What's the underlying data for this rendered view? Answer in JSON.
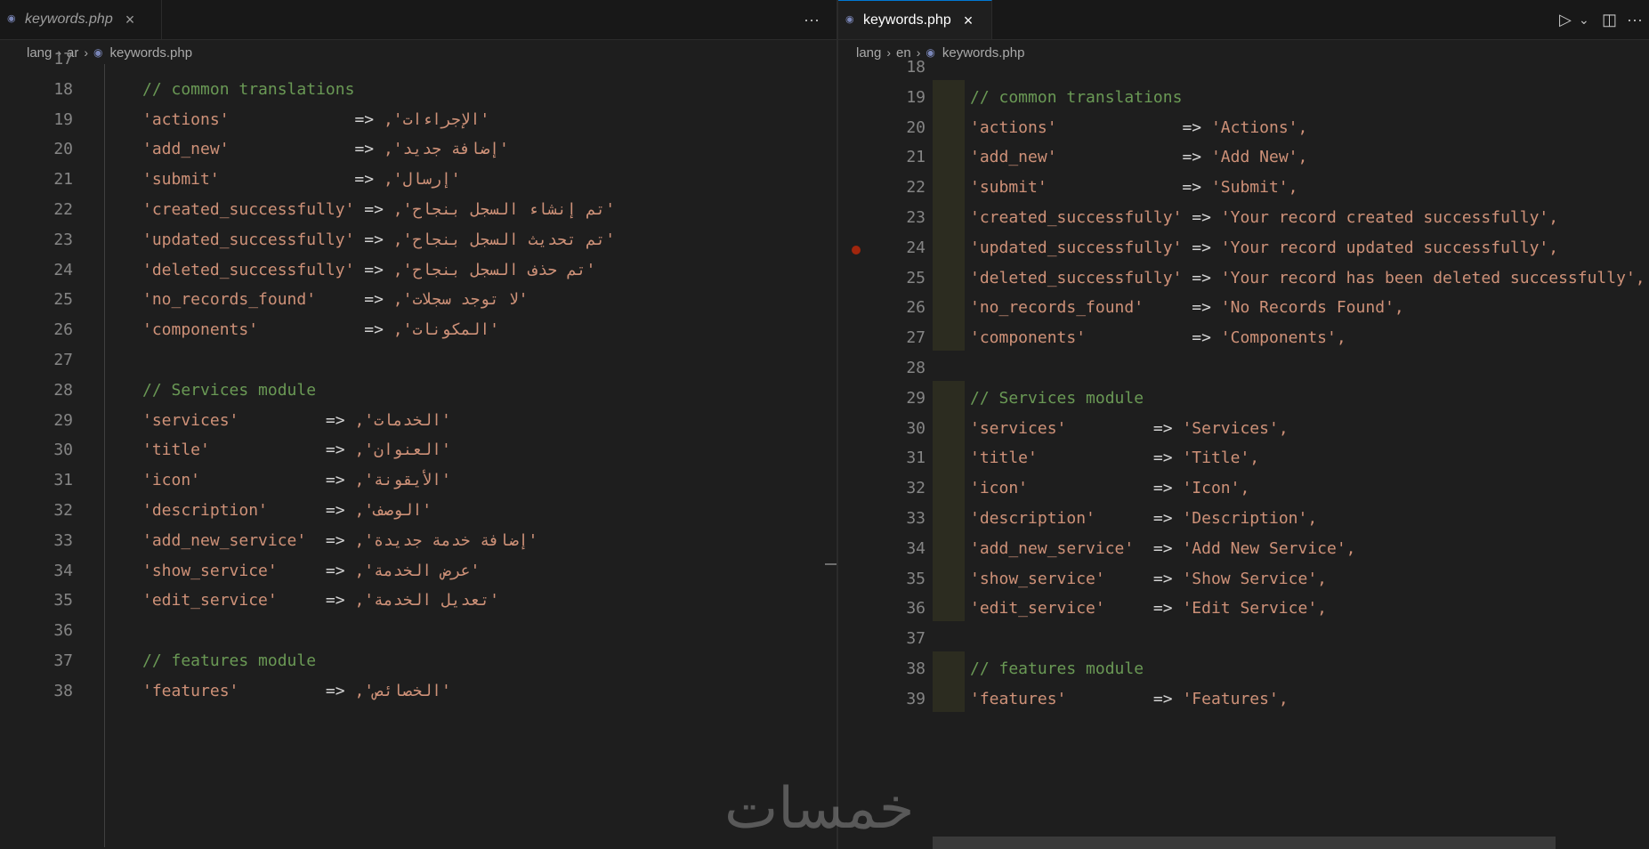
{
  "left": {
    "tab": {
      "label": "keywords.php",
      "close": "×"
    },
    "more": "···",
    "breadcrumb": [
      "lang",
      "ar",
      "keywords.php"
    ],
    "lines": [
      {
        "n": "17",
        "type": "blank"
      },
      {
        "n": "18",
        "type": "comment",
        "text": "// common translations"
      },
      {
        "n": "19",
        "type": "kv",
        "key": "'actions'",
        "pad": "             ",
        "value": "'الإجراءات',"
      },
      {
        "n": "20",
        "type": "kv",
        "key": "'add_new'",
        "pad": "             ",
        "value": "'إضافة جديد',"
      },
      {
        "n": "21",
        "type": "kv",
        "key": "'submit'",
        "pad": "              ",
        "value": "'إرسال',"
      },
      {
        "n": "22",
        "type": "kv",
        "key": "'created_successfully'",
        "pad": " ",
        "value": "'تم إنشاء السجل بنجاح',"
      },
      {
        "n": "23",
        "type": "kv",
        "key": "'updated_successfully'",
        "pad": " ",
        "value": "'تم تحديث السجل بنجاح',"
      },
      {
        "n": "24",
        "type": "kv",
        "key": "'deleted_successfully'",
        "pad": " ",
        "value": "'تم حذف السجل بنجاح',"
      },
      {
        "n": "25",
        "type": "kv",
        "key": "'no_records_found'",
        "pad": "     ",
        "value": "'لا توجد سجلات',"
      },
      {
        "n": "26",
        "type": "kv",
        "key": "'components'",
        "pad": "           ",
        "value": "'المكونات',"
      },
      {
        "n": "27",
        "type": "blank"
      },
      {
        "n": "28",
        "type": "comment",
        "text": "// Services module"
      },
      {
        "n": "29",
        "type": "kv",
        "key": "'services'",
        "pad": "         ",
        "value": "'الخدمات',"
      },
      {
        "n": "30",
        "type": "kv",
        "key": "'title'",
        "pad": "            ",
        "value": "'العنوان',"
      },
      {
        "n": "31",
        "type": "kv",
        "key": "'icon'",
        "pad": "             ",
        "value": "'الأيقونة',"
      },
      {
        "n": "32",
        "type": "kv",
        "key": "'description'",
        "pad": "      ",
        "value": "'الوصف',"
      },
      {
        "n": "33",
        "type": "kv",
        "key": "'add_new_service'",
        "pad": "  ",
        "value": "'إضافة خدمة جديدة',"
      },
      {
        "n": "34",
        "type": "kv",
        "key": "'show_service'",
        "pad": "     ",
        "value": "'عرض الخدمة',"
      },
      {
        "n": "35",
        "type": "kv",
        "key": "'edit_service'",
        "pad": "     ",
        "value": "'تعديل الخدمة',"
      },
      {
        "n": "36",
        "type": "blank"
      },
      {
        "n": "37",
        "type": "comment",
        "text": "// features module"
      },
      {
        "n": "38",
        "type": "kv",
        "key": "'features'",
        "pad": "         ",
        "value": "'الخصائص',"
      }
    ]
  },
  "right": {
    "tab": {
      "label": "keywords.php",
      "close": "×"
    },
    "actions": {
      "run": "▷",
      "run_menu": "⌄",
      "split": "◫",
      "more": "···"
    },
    "breadcrumb": [
      "lang",
      "en",
      "keywords.php"
    ],
    "lines": [
      {
        "n": "18",
        "type": "blank"
      },
      {
        "n": "19",
        "type": "comment",
        "text": "// common translations"
      },
      {
        "n": "20",
        "type": "kv",
        "key": "'actions'",
        "pad": "             ",
        "value": "'Actions',"
      },
      {
        "n": "21",
        "type": "kv",
        "key": "'add_new'",
        "pad": "             ",
        "value": "'Add New',"
      },
      {
        "n": "22",
        "type": "kv",
        "key": "'submit'",
        "pad": "              ",
        "value": "'Submit',"
      },
      {
        "n": "23",
        "type": "kv",
        "key": "'created_successfully'",
        "pad": " ",
        "value": "'Your record created successfully',"
      },
      {
        "n": "24",
        "type": "kv",
        "key": "'updated_successfully'",
        "pad": " ",
        "value": "'Your record updated successfully',",
        "breakpoint": true
      },
      {
        "n": "25",
        "type": "kv",
        "key": "'deleted_successfully'",
        "pad": " ",
        "value": "'Your record has been deleted successfully',"
      },
      {
        "n": "26",
        "type": "kv",
        "key": "'no_records_found'",
        "pad": "     ",
        "value": "'No Records Found',"
      },
      {
        "n": "27",
        "type": "kv",
        "key": "'components'",
        "pad": "           ",
        "value": "'Components',"
      },
      {
        "n": "28",
        "type": "blank"
      },
      {
        "n": "29",
        "type": "comment",
        "text": "// Services module"
      },
      {
        "n": "30",
        "type": "kv",
        "key": "'services'",
        "pad": "         ",
        "value": "'Services',"
      },
      {
        "n": "31",
        "type": "kv",
        "key": "'title'",
        "pad": "            ",
        "value": "'Title',"
      },
      {
        "n": "32",
        "type": "kv",
        "key": "'icon'",
        "pad": "             ",
        "value": "'Icon',"
      },
      {
        "n": "33",
        "type": "kv",
        "key": "'description'",
        "pad": "      ",
        "value": "'Description',"
      },
      {
        "n": "34",
        "type": "kv",
        "key": "'add_new_service'",
        "pad": "  ",
        "value": "'Add New Service',"
      },
      {
        "n": "35",
        "type": "kv",
        "key": "'show_service'",
        "pad": "     ",
        "value": "'Show Service',"
      },
      {
        "n": "36",
        "type": "kv",
        "key": "'edit_service'",
        "pad": "     ",
        "value": "'Edit Service',"
      },
      {
        "n": "37",
        "type": "blank"
      },
      {
        "n": "38",
        "type": "comment",
        "text": "// features module"
      },
      {
        "n": "39",
        "type": "kv",
        "key": "'features'",
        "pad": "         ",
        "value": "'Features',"
      }
    ]
  },
  "operator": "=>",
  "watermark": "خمسات",
  "colors": {
    "string": "#ce9178",
    "comment": "#6a9955",
    "line_number": "#858585",
    "breakpoint": "#a1260d",
    "accent": "#0078d4"
  }
}
